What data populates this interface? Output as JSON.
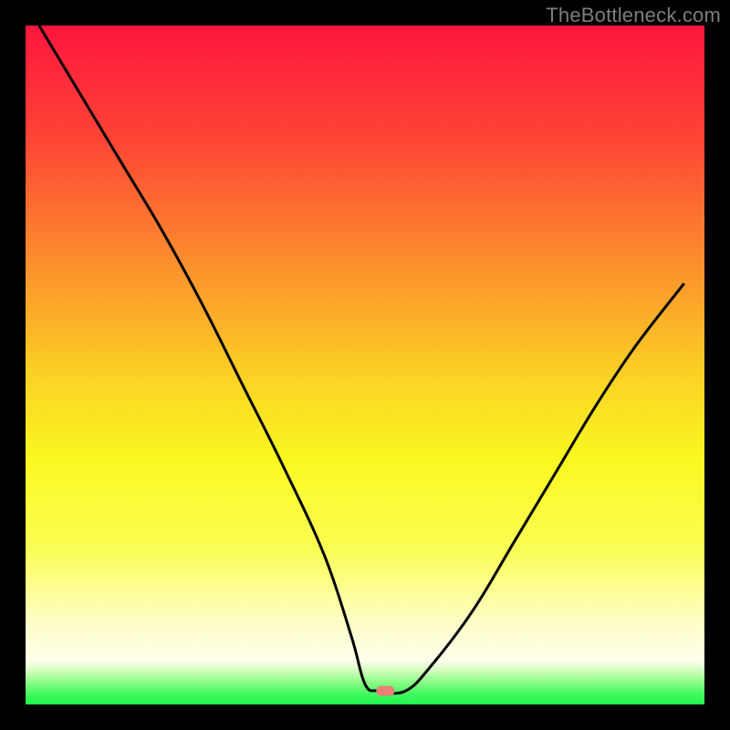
{
  "watermark": "TheBottleneck.com",
  "chart_data": {
    "type": "line",
    "title": "",
    "xlabel": "",
    "ylabel": "",
    "xlim": [
      0,
      100
    ],
    "ylim": [
      0,
      100
    ],
    "grid": false,
    "legend": false,
    "gradient_stops": [
      {
        "offset": 0,
        "color": "#ff163d"
      },
      {
        "offset": 0.16,
        "color": "#fe4236"
      },
      {
        "offset": 0.34,
        "color": "#fc8b2d"
      },
      {
        "offset": 0.52,
        "color": "#fbd324"
      },
      {
        "offset": 0.64,
        "color": "#faf820"
      },
      {
        "offset": 0.77,
        "color": "#fbfe53"
      },
      {
        "offset": 0.88,
        "color": "#fdfec7"
      },
      {
        "offset": 0.935,
        "color": "#feffeb"
      },
      {
        "offset": 0.95,
        "color": "#d4fec1"
      },
      {
        "offset": 0.965,
        "color": "#95fc8c"
      },
      {
        "offset": 0.985,
        "color": "#41f95e"
      },
      {
        "offset": 1.0,
        "color": "#1df84a"
      }
    ],
    "series": [
      {
        "name": "bottleneck-curve",
        "color": "#000000",
        "x": [
          2,
          8,
          14,
          20,
          26,
          32,
          38,
          44,
          48,
          50,
          52,
          56,
          60,
          66,
          72,
          78,
          84,
          90,
          97
        ],
        "values": [
          100,
          90,
          80,
          70,
          59,
          47,
          35,
          22,
          10,
          3,
          2,
          2,
          6,
          14,
          24,
          34,
          44,
          53,
          62
        ]
      }
    ],
    "marker": {
      "x": 53,
      "y": 2,
      "color": "#e98176"
    }
  }
}
